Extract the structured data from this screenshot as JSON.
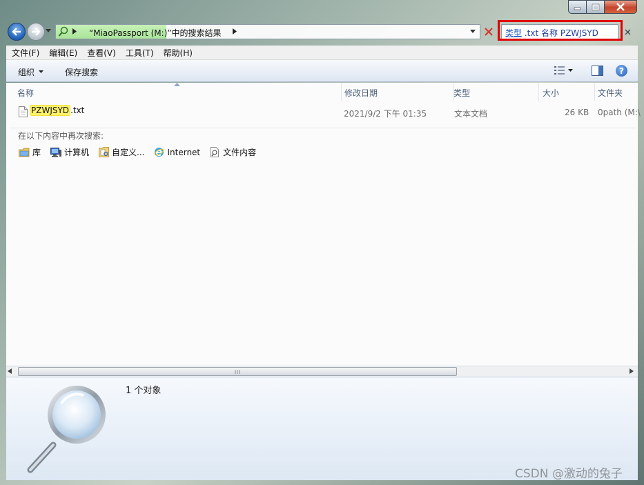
{
  "address": {
    "location_name": "“MiaoPassport (M:)”中的搜索结果"
  },
  "search": {
    "kind_keyword": "类型",
    "type_value": ".txt",
    "name_keyword": "名称",
    "name_value": "PZWJSYD"
  },
  "menu": [
    "文件(F)",
    "编辑(E)",
    "查看(V)",
    "工具(T)",
    "帮助(H)"
  ],
  "toolbar": {
    "organize_label": "组织",
    "save_search_label": "保存搜索",
    "help_label": "?"
  },
  "columns": [
    "名称",
    "修改日期",
    "类型",
    "大小",
    "文件夹"
  ],
  "file": {
    "name_match": "PZWJSYD",
    "name_ext": ".txt",
    "modified": "2021/9/2 下午 01:35",
    "type": "文本文档",
    "size": "26 KB",
    "folder": "0path (M:\\"
  },
  "search_again": {
    "label": "在以下内容中再次搜索:",
    "locations": [
      "库",
      "计算机",
      "自定义...",
      "Internet",
      "文件内容"
    ]
  },
  "status": {
    "count": "1 个对象"
  },
  "watermark": "CSDN @激动的兔子",
  "colors": {
    "highlight_yellow": "#fff36b",
    "address_green": "#b6ebaa",
    "annotation_red": "#e00000"
  }
}
